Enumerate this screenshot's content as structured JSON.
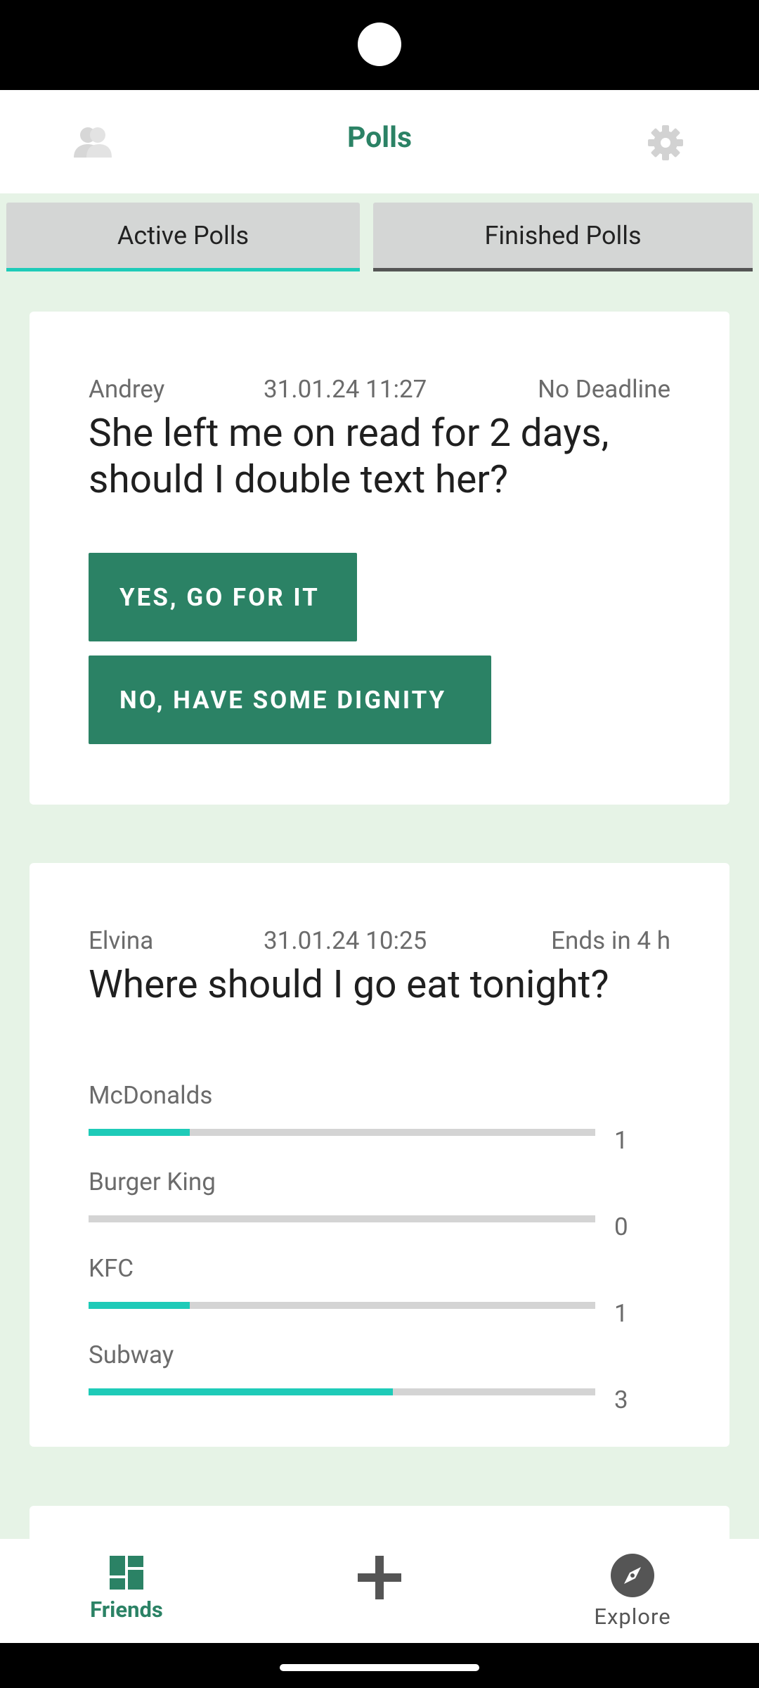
{
  "header": {
    "title": "Polls"
  },
  "tabs": [
    {
      "label": "Active Polls",
      "active": true
    },
    {
      "label": "Finished Polls",
      "active": false
    }
  ],
  "polls": [
    {
      "author": "Andrey",
      "date": "31.01.24 11:27",
      "deadline": "No Deadline",
      "question": "She left me on read for 2 days, should I double text her?",
      "answers": [
        "YES, GO FOR IT",
        "NO, HAVE SOME DIGNITY"
      ]
    },
    {
      "author": "Elvina",
      "date": "31.01.24 10:25",
      "deadline": "Ends in 4 h",
      "question": "Where should I go eat tonight?",
      "options": [
        {
          "label": "McDonalds",
          "votes": "1",
          "fill_fraction": 0.2
        },
        {
          "label": "Burger King",
          "votes": "0",
          "fill_fraction": 0.0
        },
        {
          "label": "KFC",
          "votes": "1",
          "fill_fraction": 0.2
        },
        {
          "label": "Subway",
          "votes": "3",
          "fill_fraction": 0.6
        }
      ]
    }
  ],
  "bottom_nav": {
    "friends": "Friends",
    "explore": "Explore"
  },
  "colors": {
    "brand_green": "#2b8265",
    "accent_teal": "#1ecbb8",
    "background": "#e6f3e6"
  }
}
